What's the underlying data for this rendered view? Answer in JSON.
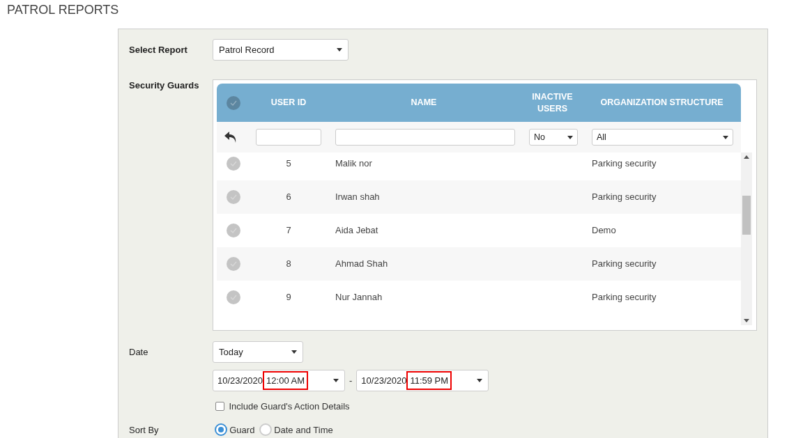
{
  "page_title": "PATROL REPORTS",
  "report": {
    "label": "Select Report",
    "value": "Patrol Record"
  },
  "guards": {
    "label": "Security Guards",
    "columns": [
      {
        "kind": "check",
        "checked": false
      },
      {
        "kind": "text",
        "label": "USER ID"
      },
      {
        "kind": "text",
        "label": "NAME"
      },
      {
        "kind": "text",
        "label": "INACTIVE USERS"
      },
      {
        "kind": "text",
        "label": "ORGANIZATION STRUCTURE"
      }
    ],
    "filters": {
      "inactive": "No",
      "organization": "All"
    },
    "rows": [
      {
        "user_id": "5",
        "name": "Malik nor",
        "organization": "Parking security",
        "selected": false
      },
      {
        "user_id": "6",
        "name": "Irwan shah",
        "organization": "Parking security",
        "selected": false
      },
      {
        "user_id": "7",
        "name": "Aida Jebat",
        "organization": "Demo",
        "selected": false
      },
      {
        "user_id": "8",
        "name": "Ahmad Shah",
        "organization": "Parking security",
        "selected": false
      },
      {
        "user_id": "9",
        "name": "Nur Jannah",
        "organization": "Parking security",
        "selected": false
      }
    ]
  },
  "date": {
    "label": "Date",
    "range": "Today",
    "from": {
      "date": "10/23/2020",
      "time": "12:00 AM",
      "highlighted": true
    },
    "separator": "-",
    "to": {
      "date": "10/23/2020",
      "time": "11:59 PM",
      "highlighted": true
    }
  },
  "include_details": {
    "label": "Include Guard's Action Details",
    "checked": false
  },
  "sort": {
    "label": "Sort By",
    "options": [
      {
        "label": "Guard",
        "selected": true
      },
      {
        "label": "Date and Time",
        "selected": false
      }
    ]
  }
}
